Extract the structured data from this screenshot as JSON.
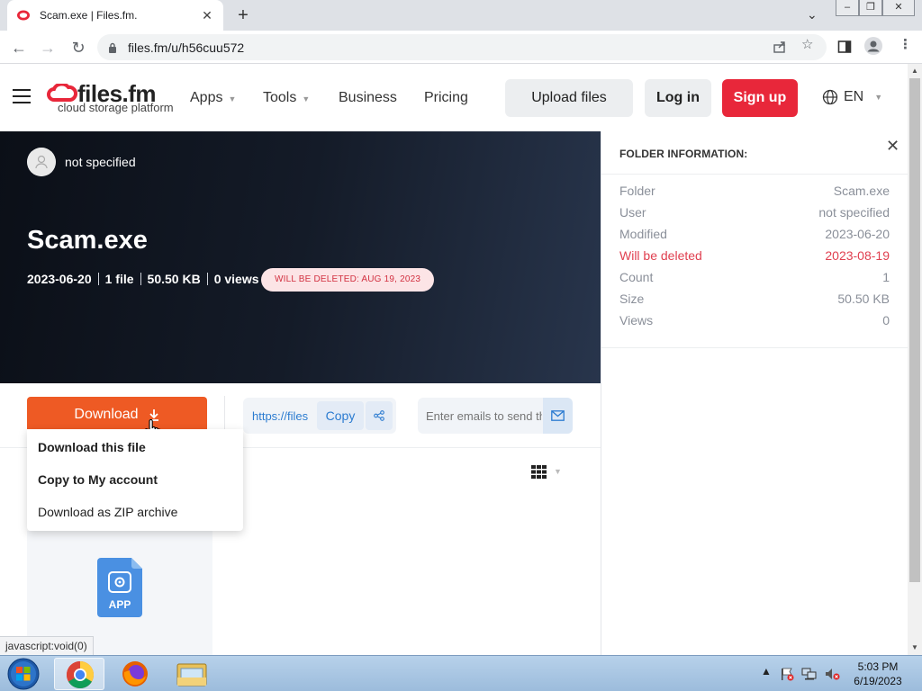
{
  "browser": {
    "tab_title": "Scam.exe | Files.fm.",
    "url": "files.fm/u/h56cuu572"
  },
  "site": {
    "logo_name": "files.fm",
    "logo_tagline": "cloud storage platform",
    "nav": {
      "apps": "Apps",
      "tools": "Tools",
      "business": "Business",
      "pricing": "Pricing"
    },
    "upload": "Upload files",
    "login": "Log in",
    "signup": "Sign up",
    "language": "EN"
  },
  "hero": {
    "owner": "not specified",
    "title": "Scam.exe",
    "date": "2023-06-20",
    "files": "1 file",
    "size": "50.50 KB",
    "views": "0 views",
    "badge": "WILL BE DELETED: AUG 19, 2023"
  },
  "actions": {
    "download": "Download",
    "share_url": "https://files",
    "copy": "Copy",
    "email_placeholder": "Enter emails to send the link"
  },
  "dropdown": {
    "item1": "Download this file",
    "item2": "Copy to My account",
    "item3": "Download as ZIP archive"
  },
  "file": {
    "icon_label": "APP"
  },
  "info": {
    "heading": "FOLDER INFORMATION:",
    "rows": [
      {
        "label": "Folder",
        "value": "Scam.exe"
      },
      {
        "label": "User",
        "value": "not specified"
      },
      {
        "label": "Modified",
        "value": "2023-06-20"
      },
      {
        "label": "Will be deleted",
        "value": "2023-08-19"
      },
      {
        "label": "Count",
        "value": "1"
      },
      {
        "label": "Size",
        "value": "50.50 KB"
      },
      {
        "label": "Views",
        "value": "0"
      }
    ]
  },
  "status_text": "javascript:void(0)",
  "clock": {
    "time": "5:03 PM",
    "date": "6/19/2023"
  },
  "colors": {
    "brand_red": "#e8273a",
    "download_orange": "#ee5a24",
    "link_blue": "#2b7bd0",
    "delete_red": "#e04050"
  }
}
